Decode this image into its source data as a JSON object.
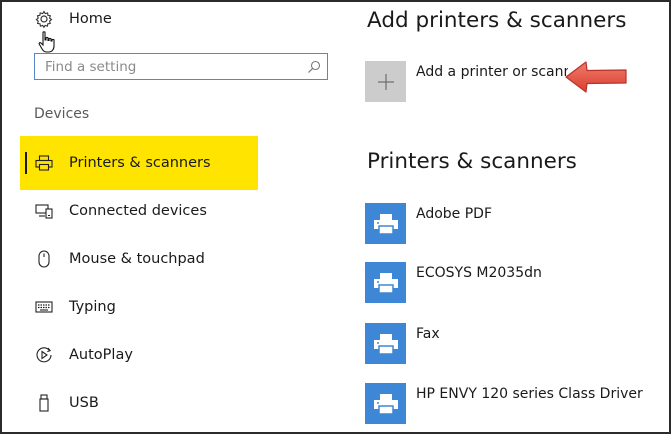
{
  "colors": {
    "highlight": "#ffe400",
    "accent_tile": "#3e86d6",
    "add_tile": "#cccccc",
    "annotation_arrow": "#e8584b",
    "search_border": "#5a86c6"
  },
  "nav": {
    "home": {
      "label": "Home",
      "icon": "gear-icon"
    },
    "search": {
      "placeholder": "Find a setting",
      "icon": "search-icon"
    },
    "section_title": "Devices",
    "items": [
      {
        "label": "Printers & scanners",
        "icon": "printer-icon",
        "selected": true
      },
      {
        "label": "Connected devices",
        "icon": "connected-devices-icon"
      },
      {
        "label": "Mouse & touchpad",
        "icon": "mouse-icon"
      },
      {
        "label": "Typing",
        "icon": "keyboard-icon"
      },
      {
        "label": "AutoPlay",
        "icon": "autoplay-icon"
      },
      {
        "label": "USB",
        "icon": "usb-icon"
      }
    ]
  },
  "main": {
    "add_heading": "Add printers & scanners",
    "add_button_label": "Add a printer or scanner",
    "list_heading": "Printers & scanners",
    "printers": [
      {
        "name": "Adobe PDF"
      },
      {
        "name": "ECOSYS M2035dn"
      },
      {
        "name": "Fax"
      },
      {
        "name": "HP ENVY 120 series Class Driver"
      }
    ]
  }
}
